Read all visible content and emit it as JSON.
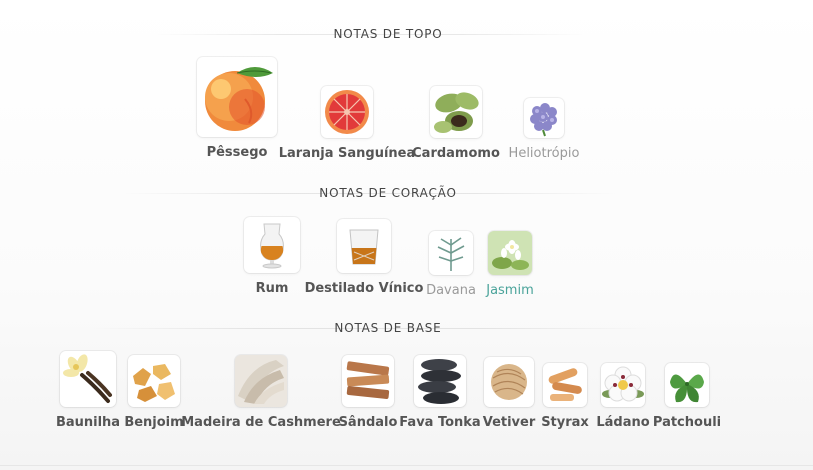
{
  "top": {
    "title": "NOTAS DE TOPO",
    "notes": [
      {
        "label": "Pêssego",
        "icon": "peach-icon"
      },
      {
        "label": "Laranja Sanguínea",
        "icon": "blood-orange-icon"
      },
      {
        "label": "Cardamomo",
        "icon": "cardamom-icon"
      },
      {
        "label": "Heliotrópio",
        "icon": "heliotrope-icon"
      }
    ]
  },
  "heart": {
    "title": "NOTAS DE CORAÇÃO",
    "notes": [
      {
        "label": "Rum",
        "icon": "rum-glass-icon"
      },
      {
        "label": "Destilado Vínico",
        "icon": "whisky-glass-icon"
      },
      {
        "label": "Davana",
        "icon": "davana-icon"
      },
      {
        "label": "Jasmim",
        "icon": "jasmine-icon"
      }
    ]
  },
  "base": {
    "title": "NOTAS DE BASE",
    "notes": [
      {
        "label": "Baunilha",
        "icon": "vanilla-icon"
      },
      {
        "label": "Benjoim",
        "icon": "benzoin-icon"
      },
      {
        "label": "Madeira de Cashmere",
        "icon": "cashmere-wood-icon"
      },
      {
        "label": "Sândalo",
        "icon": "sandalwood-icon"
      },
      {
        "label": "Fava Tonka",
        "icon": "tonka-bean-icon"
      },
      {
        "label": "Vetiver",
        "icon": "vetiver-icon"
      },
      {
        "label": "Styrax",
        "icon": "styrax-icon"
      },
      {
        "label": "Ládano",
        "icon": "labdanum-icon"
      },
      {
        "label": "Patchouli",
        "icon": "patchouli-icon"
      }
    ]
  },
  "colors": {
    "muted": "#9a9a9a",
    "accent": "#4aa39a"
  }
}
